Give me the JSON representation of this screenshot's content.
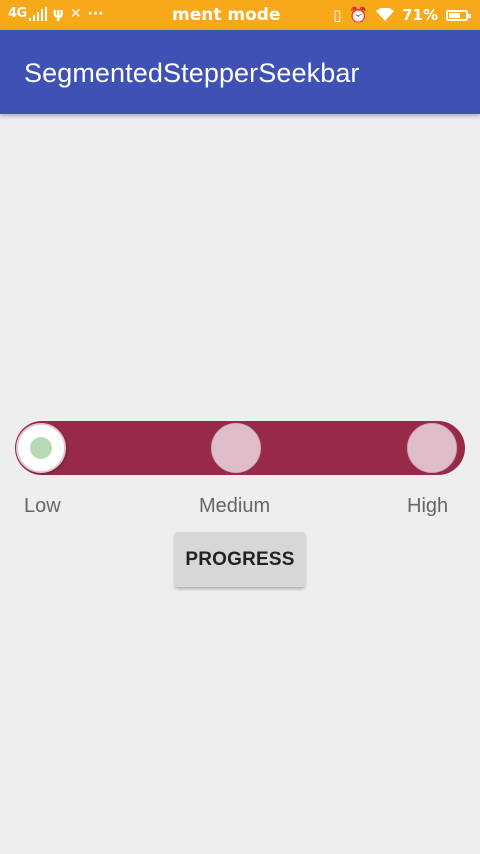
{
  "status_bar": {
    "network": "4G",
    "notification_text": "ment mode",
    "battery_percent": "71%",
    "battery_level": 0.71,
    "background_color": "#f7a91a",
    "icons": [
      "signal-icon",
      "usb-icon",
      "tools-icon",
      "more-dots-icon",
      "vibrate-icon",
      "alarm-icon",
      "wifi-icon",
      "battery-charging-icon"
    ]
  },
  "app_bar": {
    "title": "SegmentedStepperSeekbar",
    "background_color": "#3f51b5"
  },
  "seekbar": {
    "track_color": "#972a48",
    "thumb_color": "#b7d9b6",
    "selected_segment": "Low",
    "segments": [
      {
        "label": "Low"
      },
      {
        "label": "Medium"
      },
      {
        "label": "High"
      }
    ]
  },
  "button": {
    "label": "PROGRESS"
  }
}
